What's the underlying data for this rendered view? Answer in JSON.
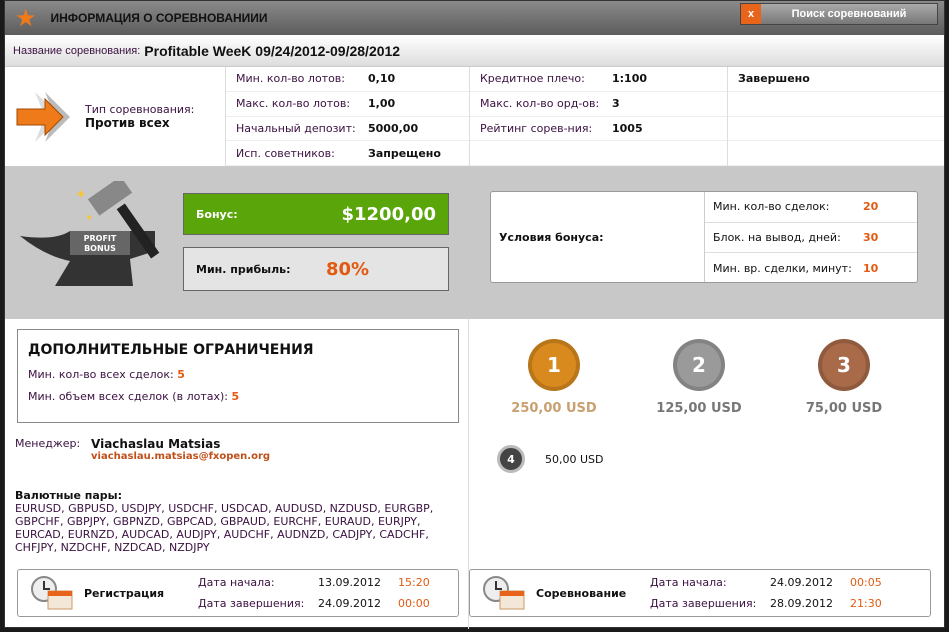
{
  "window": {
    "title": "ИНФОРМАЦИЯ О СОРЕВНОВАНИИИ",
    "search_button": "Поиск соревнований",
    "close": "x"
  },
  "competition": {
    "name_label": "Название соревнования:",
    "name": "Profitable WeeK 09/24/2012-09/28/2012",
    "type_label": "Тип соревнования:",
    "type": "Против всех",
    "status": "Завершено"
  },
  "params1": [
    {
      "k": "Мин. кол-во лотов:",
      "v": "0,10"
    },
    {
      "k": "Макс. кол-во лотов:",
      "v": "1,00"
    },
    {
      "k": "Начальный депозит:",
      "v": "5000,00"
    },
    {
      "k": "Исп. советников:",
      "v": "Запрещено"
    }
  ],
  "params2": [
    {
      "k": "Кредитное плечо:",
      "v": "1:100"
    },
    {
      "k": "Макс. кол-во орд-ов:",
      "v": "3"
    },
    {
      "k": "Рейтинг сорев-ния:",
      "v": "1005"
    }
  ],
  "bonus": {
    "logo_text": "PROFIT BONUS",
    "label": "Бонус:",
    "value": "$1200,00",
    "min_profit_label": "Мин. прибыль:",
    "min_profit": "80%",
    "conditions_label": "Условия бонуса:",
    "conditions": [
      {
        "k": "Мин. кол-во сделок:",
        "v": "20"
      },
      {
        "k": "Блок. на вывод, дней:",
        "v": "30"
      },
      {
        "k": "Мин. вр. сделки, минут:",
        "v": "10"
      }
    ]
  },
  "limits": {
    "title": "ДОПОЛНИТЕЛЬНЫЕ ОГРАНИЧЕНИЯ",
    "items": [
      {
        "k": "Мин. кол-во всех сделок:",
        "v": "5"
      },
      {
        "k": "Мин. объем всех сделок (в лотах):",
        "v": "5"
      }
    ]
  },
  "manager": {
    "label": "Менеджер:",
    "name": "Viachaslau Matsias",
    "email": "viachaslau.matsias@fxopen.org"
  },
  "pairs": {
    "label": "Валютные пары:",
    "list": "EURUSD, GBPUSD, USDJPY, USDCHF, USDCAD, AUDUSD, NZDUSD, EURGBP, GBPCHF, GBPJPY, GBPNZD, GBPCAD, GBPAUD, EURCHF, EURAUD, EURJPY, EURCAD, EURNZD, AUDCAD, AUDJPY, AUDCHF, AUDNZD, CADJPY, CADCHF, CHFJPY, NZDCHF, NZDCAD, NZDJPY"
  },
  "prizes": [
    {
      "place": "1",
      "amount": "250,00 USD",
      "color": "#d98a1e"
    },
    {
      "place": "2",
      "amount": "125,00 USD",
      "color": "#9a9a9a"
    },
    {
      "place": "3",
      "amount": "75,00 USD",
      "color": "#a86a48"
    },
    {
      "place": "4",
      "amount": "50,00 USD",
      "color": "#444444"
    }
  ],
  "registration": {
    "title": "Регистрация",
    "start_label": "Дата начала:",
    "start_date": "13.09.2012",
    "start_time": "15:20",
    "end_label": "Дата завершения:",
    "end_date": "24.09.2012",
    "end_time": "00:00"
  },
  "contest": {
    "title": "Соревнование",
    "start_label": "Дата начала:",
    "start_date": "24.09.2012",
    "start_time": "00:05",
    "end_label": "Дата завершения:",
    "end_date": "28.09.2012",
    "end_time": "21:30"
  }
}
